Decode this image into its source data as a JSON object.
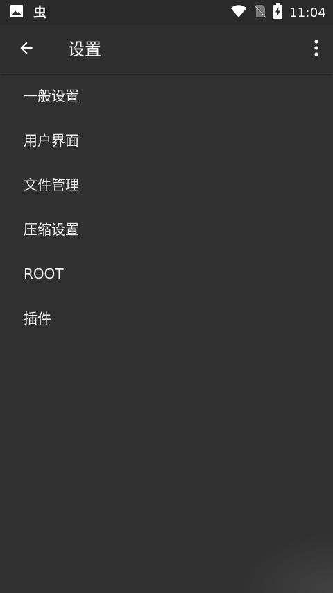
{
  "status_bar": {
    "time": "11:04",
    "notification_badge": "虫",
    "icons": [
      "image-icon",
      "bug-icon",
      "wifi-icon",
      "no-sim-icon",
      "battery-charging-icon"
    ]
  },
  "app_bar": {
    "title": "设置",
    "back_icon": "arrow-left-icon",
    "more_icon": "more-vertical-icon"
  },
  "settings": {
    "items": [
      {
        "label": "一般设置"
      },
      {
        "label": "用户界面"
      },
      {
        "label": "文件管理"
      },
      {
        "label": "压缩设置"
      },
      {
        "label": "ROOT"
      },
      {
        "label": "插件"
      }
    ]
  },
  "colors": {
    "background": "#303030",
    "app_bar": "#2f2f2f",
    "status_bar": "#2a2a2a",
    "text": "#f0f0f0"
  }
}
